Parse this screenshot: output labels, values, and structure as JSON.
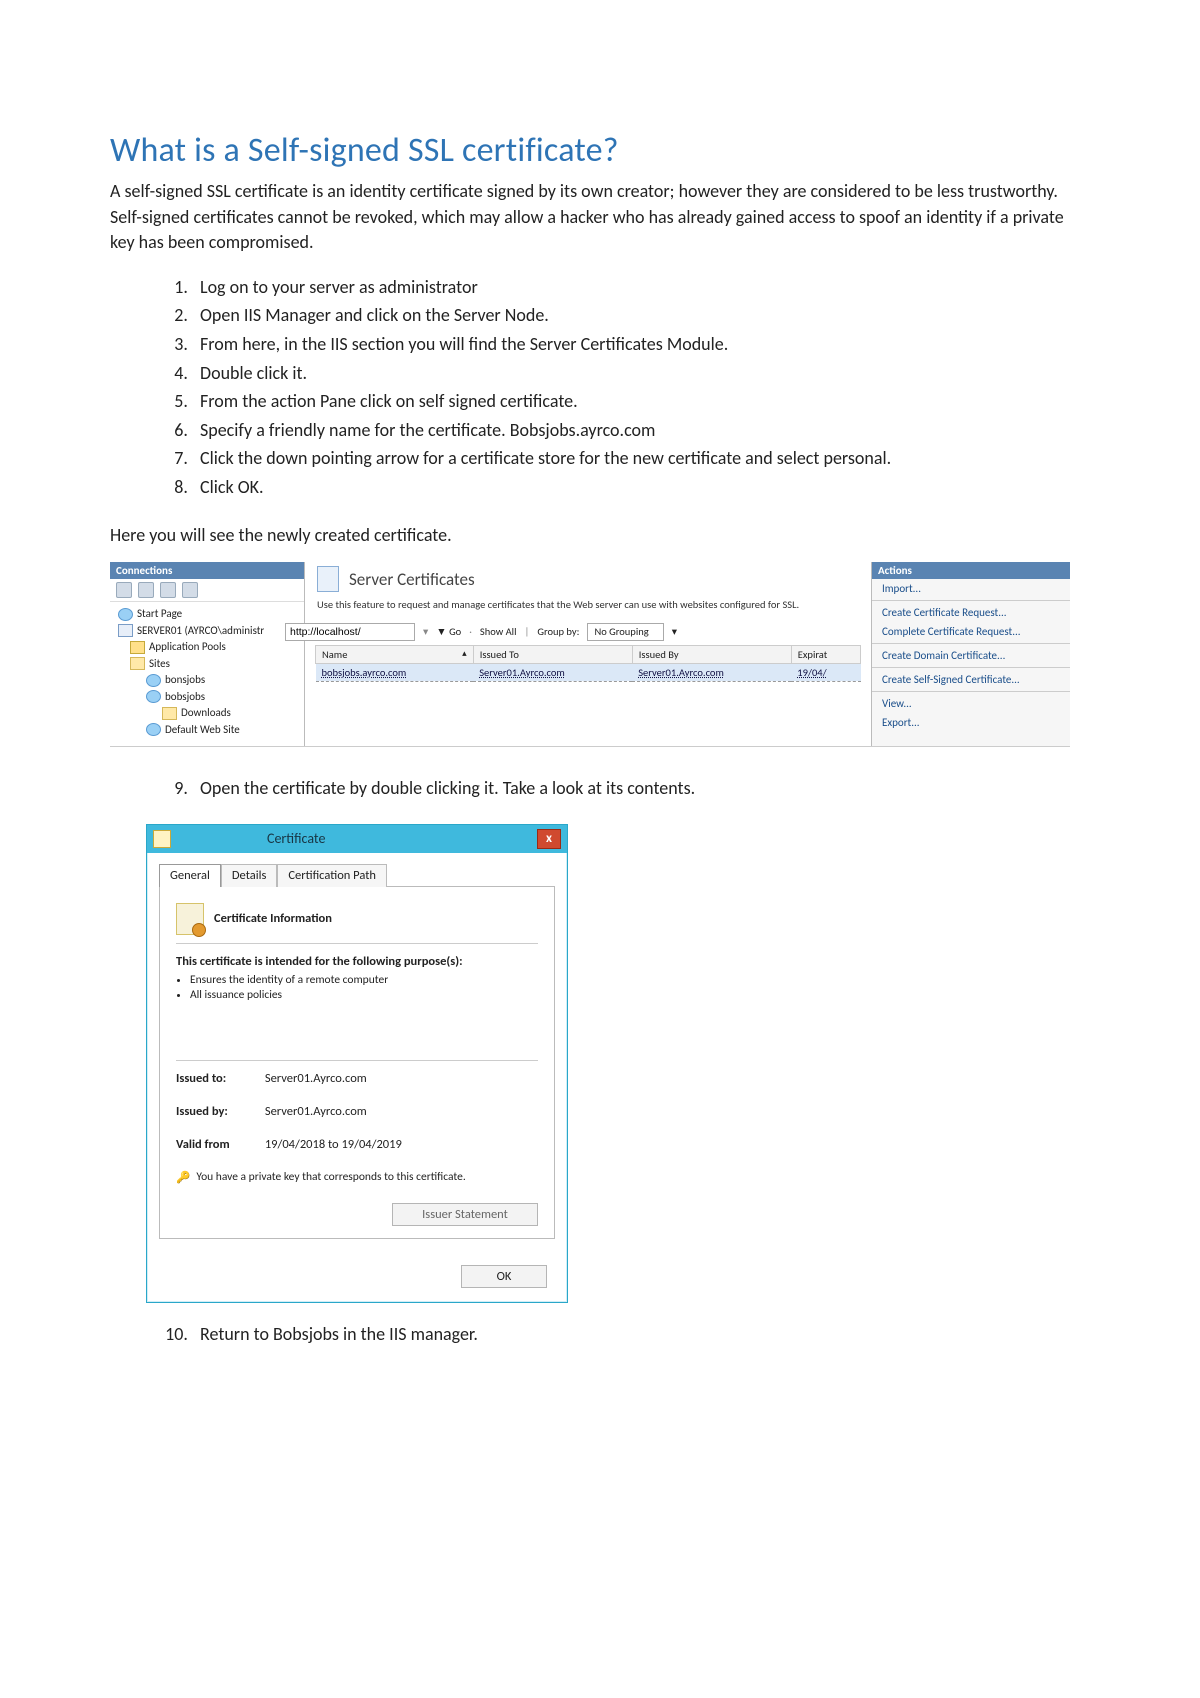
{
  "doc": {
    "title": "What is a Self-signed SSL certificate?",
    "intro": "A self-signed SSL certificate is an identity certificate signed by its own creator; however they are considered to be less trustworthy. Self-signed certificates cannot be revoked, which may allow a hacker who has already gained access to spoof an identity if a private key has been compromised.",
    "steps_a": [
      "Log on to your server as administrator",
      "Open IIS Manager and click on the Server Node.",
      "From here, in the IIS section you will find the Server Certificates Module.",
      "Double click it.",
      "From the action Pane click on self signed certificate.",
      "Specify a friendly name for the certificate. Bobsjobs.ayrco.com",
      "Click the down pointing arrow for a certificate store for the new certificate and select personal.",
      "Click OK."
    ],
    "after_steps": "Here you will see the newly created certificate.",
    "step9": "Open the certificate by double clicking it. Take a look at its contents.",
    "step10": "Return to Bobsjobs in the IIS manager."
  },
  "iis": {
    "connections_hdr": "Connections",
    "actions_hdr": "Actions",
    "tree": {
      "start": "Start Page",
      "server": "SERVER01 (AYRCO\\administr",
      "apppools": "Application Pools",
      "sites": "Sites",
      "bonsjobs": "bonsjobs",
      "bobsjobs": "bobsjobs",
      "downloads": "Downloads",
      "default": "Default Web Site"
    },
    "main_title": "Server Certificates",
    "main_desc": "Use this feature to request and manage certificates that the Web server can use with websites configured for SSL.",
    "filter_value": "http://localhost/",
    "filter_go": "Go",
    "filter_showall": "Show All",
    "filter_groupby_lbl": "Group by:",
    "filter_groupby_val": "No Grouping",
    "grid_headers": {
      "name": "Name",
      "issued_to": "Issued To",
      "issued_by": "Issued By",
      "expires": "Expirat"
    },
    "grid_row": {
      "name": "bobsjobs.ayrco.com",
      "issued_to": "Server01.Ayrco.com",
      "issued_by": "Server01.Ayrco.com",
      "expires": "19/04/"
    },
    "actions": {
      "import": "Import...",
      "create_req": "Create Certificate Request...",
      "complete_req": "Complete Certificate Request...",
      "create_domain": "Create Domain Certificate...",
      "create_self": "Create Self-Signed Certificate...",
      "view": "View...",
      "export": "Export..."
    }
  },
  "cert": {
    "window_title": "Certificate",
    "close": "x",
    "tabs": {
      "general": "General",
      "details": "Details",
      "certpath": "Certification Path"
    },
    "info_hdr": "Certificate Information",
    "purpose_title": "This certificate is intended for the following purpose(s):",
    "purposes": [
      "Ensures the identity of a remote computer",
      "All issuance policies"
    ],
    "issued_to_lbl": "Issued to:",
    "issued_to": "Server01.Ayrco.com",
    "issued_by_lbl": "Issued by:",
    "issued_by": "Server01.Ayrco.com",
    "valid_lbl": "Valid from",
    "valid_val": "19/04/2018  to  19/04/2019",
    "pk_note": "You have a private key that corresponds to this certificate.",
    "issuer_stmt": "Issuer Statement",
    "ok": "OK"
  }
}
